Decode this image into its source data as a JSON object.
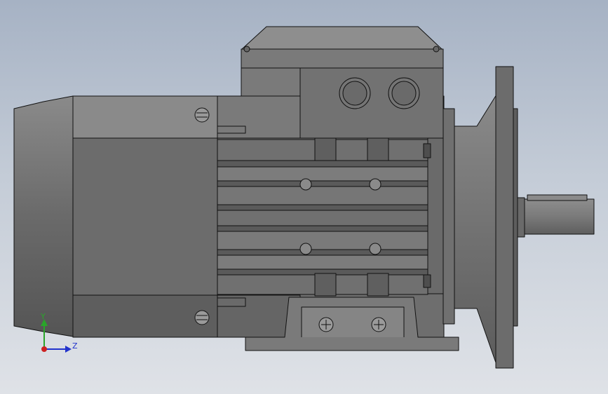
{
  "view": {
    "title": "",
    "background_top": "#a6b2c4",
    "background_bottom": "#dfe2e7"
  },
  "model": {
    "type": "three-phase electric motor with flange mount",
    "body_color": "#6f6f6f",
    "edge_color": "#111111"
  },
  "triad": {
    "y_label": "Y",
    "z_label": "Z",
    "y_color": "#2aa52a",
    "z_color": "#2233cc",
    "origin_color": "#cc2222"
  }
}
